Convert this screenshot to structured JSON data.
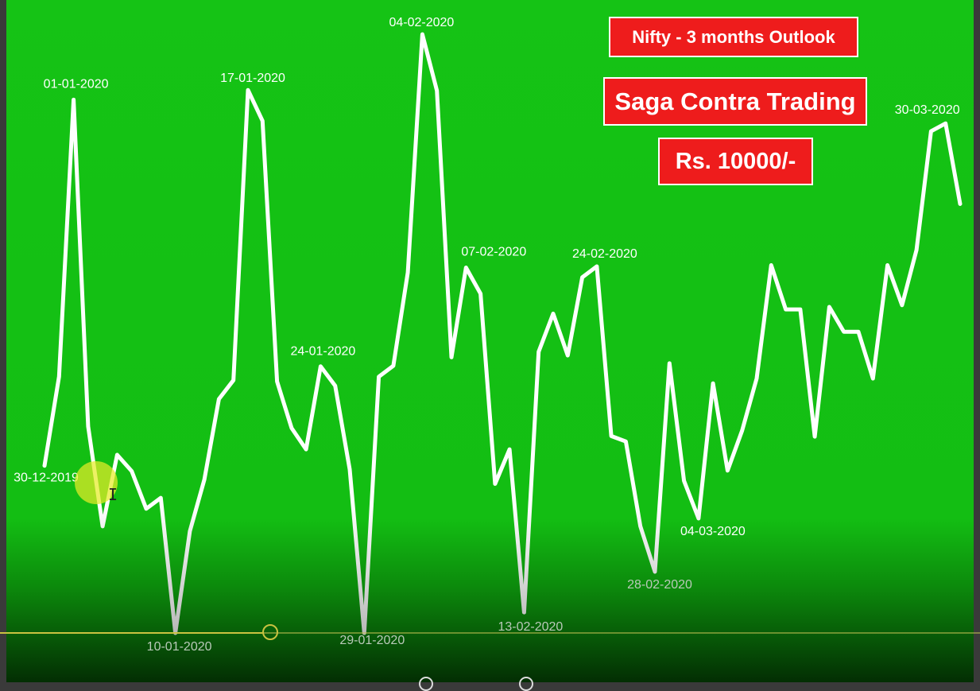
{
  "badges": {
    "title": "Nifty - 3 months Outlook",
    "brand": "Saga Contra Trading",
    "price": "Rs. 10000/-"
  },
  "colors": {
    "background": "#14c414",
    "line": "#ffffff",
    "badge_fill": "#ee1c1c",
    "badge_text": "#ffffff"
  },
  "chart_data": {
    "type": "line",
    "title": "",
    "xlabel": "",
    "ylabel": "",
    "axes_visible": false,
    "grid": false,
    "legend": "none",
    "y_units": "relative level (0 = lowest, 100 = highest), no axis printed",
    "ylim": [
      0,
      100
    ],
    "series": [
      {
        "values": [
          27.6,
          42.3,
          88.0,
          34.1,
          17.6,
          29.4,
          26.7,
          20.5,
          22.3,
          0,
          16.8,
          25.3,
          38.6,
          41.7,
          89.6,
          84.5,
          41.5,
          33.8,
          30.3,
          44.0,
          40.8,
          27.0,
          0,
          42.3,
          44.1,
          59.5,
          98.8,
          89.5,
          45.5,
          60.3,
          56.0,
          24.6,
          30.3,
          3.4,
          46.4,
          52.7,
          45.8,
          58.7,
          60.5,
          32.5,
          31.6,
          17.6,
          10.1,
          44.5,
          25.1,
          18.9,
          41.2,
          26.8,
          33.4,
          42.0,
          60.7,
          53.4,
          53.4,
          32.4,
          53.8,
          49.7,
          49.7,
          42.0,
          60.7,
          54.1,
          63.2,
          82.8,
          84.1,
          70.8
        ]
      }
    ],
    "annotations": [
      {
        "label": "30-12-2019",
        "point": 0
      },
      {
        "label": "01-01-2020",
        "point": 2
      },
      {
        "label": "10-01-2020",
        "point": 9
      },
      {
        "label": "17-01-2020",
        "point": 14
      },
      {
        "label": "24-01-2020",
        "point": 19
      },
      {
        "label": "29-01-2020",
        "point": 22
      },
      {
        "label": "04-02-2020",
        "point": 26
      },
      {
        "label": "07-02-2020",
        "point": 29
      },
      {
        "label": "13-02-2020",
        "point": 33
      },
      {
        "label": "24-02-2020",
        "point": 38
      },
      {
        "label": "28-02-2020",
        "point": 42
      },
      {
        "label": "04-03-2020",
        "point": 45
      },
      {
        "label": "30-03-2020",
        "point": 62
      }
    ]
  }
}
